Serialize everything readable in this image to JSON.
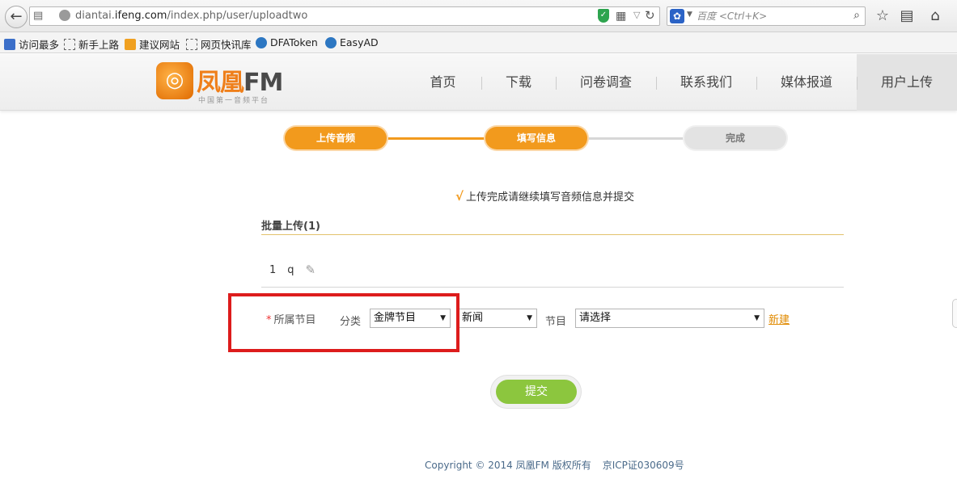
{
  "browser": {
    "url_prefix": "diantai.",
    "url_domain": "ifeng.com",
    "url_path": "/index.php/user/uploadtwo",
    "search_placeholder": "百度 <Ctrl+K>",
    "bookmarks": [
      "访问最多",
      "新手上路",
      "建议网站",
      "网页快讯库",
      "DFAToken",
      "EasyAD"
    ]
  },
  "header": {
    "logo_brand_cn": "凤凰",
    "logo_brand_fm": "FM",
    "logo_slogan": "中国第一音频平台",
    "nav": [
      "首页",
      "下载",
      "问卷调查",
      "联系我们",
      "媒体报道",
      "用户上传"
    ],
    "active_nav": "用户上传"
  },
  "steps": [
    {
      "label": "上传音频",
      "state": "done"
    },
    {
      "label": "填写信息",
      "state": "done"
    },
    {
      "label": "完成",
      "state": "todo"
    }
  ],
  "form": {
    "notice": "上传完成请继续填写音频信息并提交",
    "notice_check": "√",
    "batch_title": "批量上传(1)",
    "file": {
      "index": "1",
      "name": "q"
    },
    "program_label": "所属节目",
    "required_mark": "*",
    "category_label": "分类",
    "category_value": "金牌节目",
    "subcategory_value": "新闻",
    "program_sublabel": "节目",
    "program_value": "请选择",
    "new_link": "新建",
    "submit_label": "提交"
  },
  "footer": {
    "copyright": "Copyright © 2014 凤凰FM 版权所有",
    "icp": "京ICP证030609号"
  },
  "colors": {
    "accent_orange": "#f29a1d",
    "submit_green": "#8cc63e",
    "highlight_red": "#dd1c1c"
  }
}
